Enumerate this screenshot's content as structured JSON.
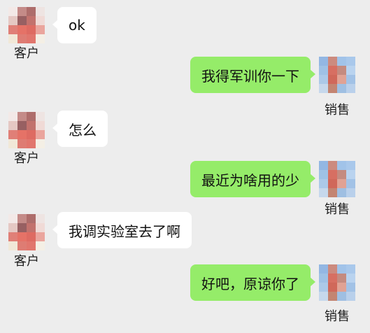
{
  "messages": [
    {
      "side": "left",
      "sender": "客户",
      "text": "ok"
    },
    {
      "side": "right",
      "sender": "销售",
      "text": "我得军训你一下"
    },
    {
      "side": "left",
      "sender": "客户",
      "text": "怎么"
    },
    {
      "side": "right",
      "sender": "销售",
      "text": "最近为啥用的少"
    },
    {
      "side": "left",
      "sender": "客户",
      "text": "我调实验室去了啊"
    },
    {
      "side": "right",
      "sender": "销售",
      "text": "好吧，原谅你了"
    }
  ],
  "colors": {
    "background": "#ededed",
    "bubble_self": "#95ec69",
    "bubble_other": "#ffffff"
  }
}
